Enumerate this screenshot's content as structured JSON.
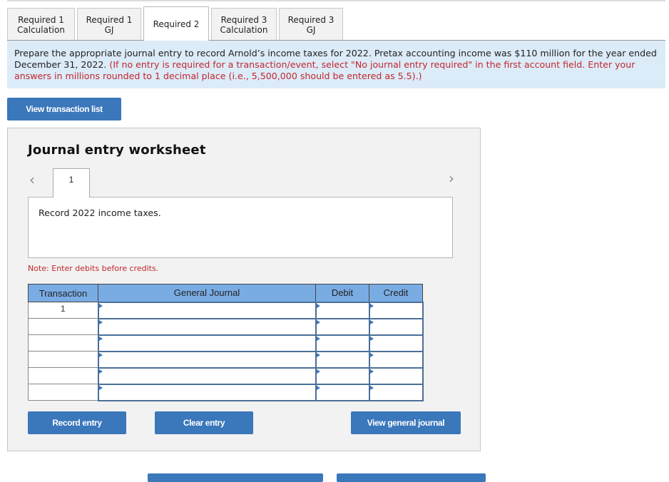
{
  "tabs": [
    {
      "label": "Required 1 Calculation",
      "active": false
    },
    {
      "label": "Required 1 GJ",
      "active": false
    },
    {
      "label": "Required 2",
      "active": true
    },
    {
      "label": "Required 3 Calculation",
      "active": false
    },
    {
      "label": "Required 3 GJ",
      "active": false
    }
  ],
  "instructions": {
    "main": "Prepare the appropriate journal entry to record Arnold’s income taxes for 2022. Pretax accounting income was $110 million for the year ended December 31, 2022.",
    "note": "(If no entry is required for a transaction/event, select \"No journal entry required\" in the first account field. Enter your answers in millions rounded to 1 decimal place (i.e., 5,500,000 should be entered as 5.5).)"
  },
  "buttons": {
    "view_transaction_list": "View transaction list",
    "record_entry": "Record entry",
    "clear_entry": "Clear entry",
    "view_general_journal": "View general journal"
  },
  "worksheet": {
    "title": "Journal entry worksheet",
    "prev_icon": "‹",
    "next_icon": "›",
    "current_tab": "1",
    "description": "Record 2022 income taxes.",
    "note": "Note: Enter debits before credits."
  },
  "table": {
    "headers": [
      "Transaction",
      "General Journal",
      "Debit",
      "Credit"
    ],
    "rows": [
      {
        "transaction": "1",
        "account": "",
        "debit": "",
        "credit": ""
      },
      {
        "transaction": "",
        "account": "",
        "debit": "",
        "credit": ""
      },
      {
        "transaction": "",
        "account": "",
        "debit": "",
        "credit": ""
      },
      {
        "transaction": "",
        "account": "",
        "debit": "",
        "credit": ""
      },
      {
        "transaction": "",
        "account": "",
        "debit": "",
        "credit": ""
      },
      {
        "transaction": "",
        "account": "",
        "debit": "",
        "credit": ""
      }
    ]
  }
}
